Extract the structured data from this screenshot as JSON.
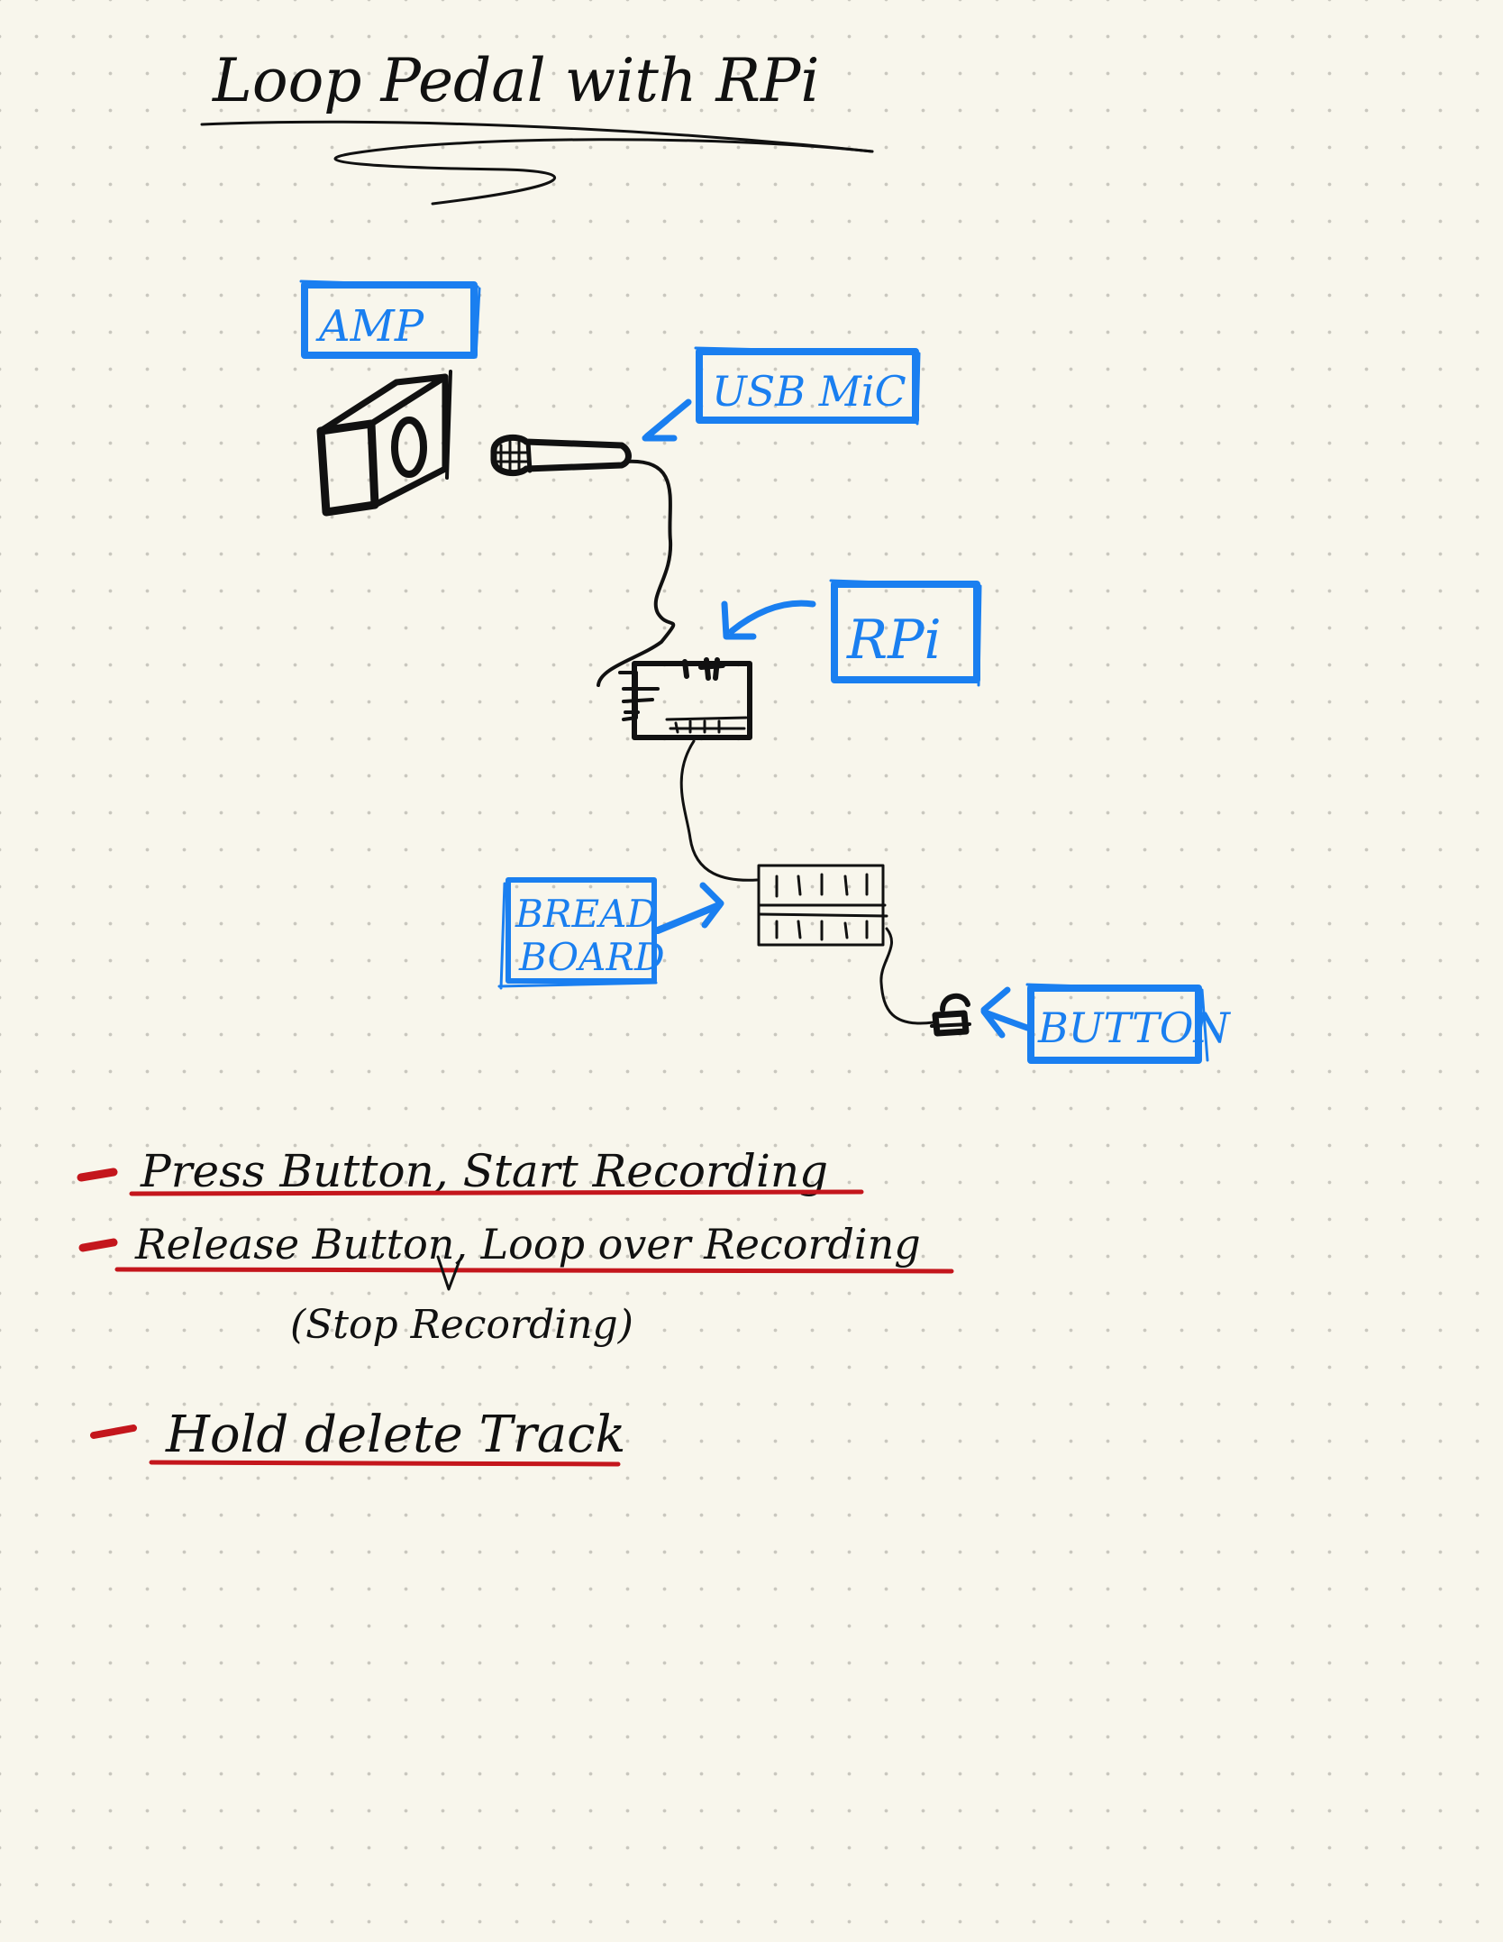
{
  "title": "Loop Pedal with RPi",
  "labels": {
    "amp": "AMP",
    "usb_mic": "USB MiC",
    "rpi": "RPi",
    "breadboard_line1": "BREAD",
    "breadboard_line2": "BOARD",
    "button": "BUTTON"
  },
  "notes": [
    {
      "text": "Press Button, Start Recording"
    },
    {
      "text": "Release Button, Loop over Recording",
      "subtext": "(Stop Recording)"
    },
    {
      "text": "Hold delete Track"
    }
  ],
  "colors": {
    "ink": "#111111",
    "label_blue": "#1a7ff0",
    "underline_red": "#c4161c",
    "paper": "#f8f6ec"
  }
}
